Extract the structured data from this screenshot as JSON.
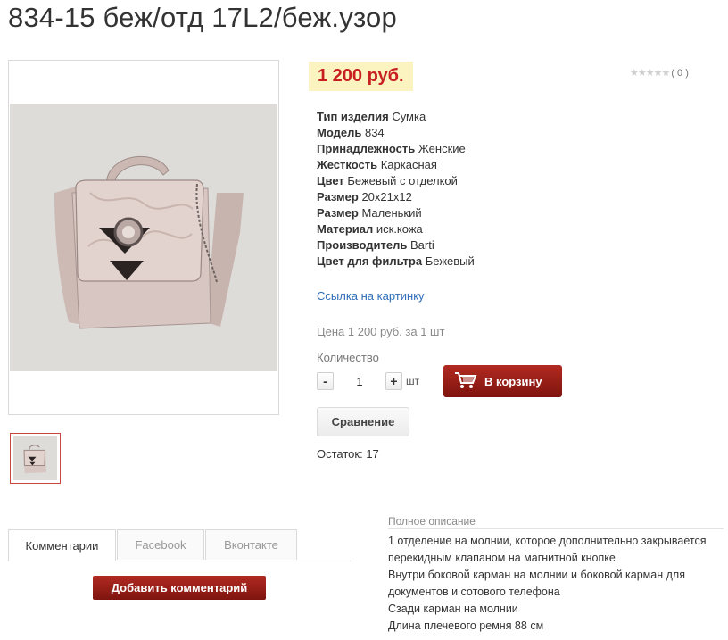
{
  "product": {
    "title": "834-15 беж/отд 17L2/беж.узор",
    "price": "1 200 руб.",
    "rating": {
      "stars": 0,
      "count_label": "( 0 )"
    },
    "properties": [
      {
        "name": "Тип изделия",
        "value": "Сумка"
      },
      {
        "name": "Модель",
        "value": "834"
      },
      {
        "name": "Принадлежность",
        "value": "Женские"
      },
      {
        "name": "Жесткость",
        "value": "Каркасная"
      },
      {
        "name": "Цвет",
        "value": "Бежевый с отделкой"
      },
      {
        "name": "Размер",
        "value": "20x21x12"
      },
      {
        "name": "Размер",
        "value": "Маленький"
      },
      {
        "name": "Материал",
        "value": "иск.кожа"
      },
      {
        "name": "Производитель",
        "value": "Barti"
      },
      {
        "name": "Цвет для фильтра",
        "value": "Бежевый"
      }
    ],
    "image_link": "Ссылка на картинку",
    "unit_price": "Цена 1 200 руб. за 1 шт",
    "stock": "Остаток: 17"
  },
  "cart": {
    "qty_label": "Количество",
    "minus": "-",
    "qty_value": "1",
    "plus": "+",
    "unit": "шт",
    "add_to_cart": "В корзину",
    "compare": "Сравнение"
  },
  "tabs": [
    {
      "label": "Комментарии",
      "active": true
    },
    {
      "label": "Facebook",
      "active": false
    },
    {
      "label": "Вконтакте",
      "active": false
    }
  ],
  "add_comment": "Добавить комментарий",
  "description": {
    "title": "Полное описание",
    "lines": [
      "1 отделение на молнии, которое дополнительно закрывается перекидным клапаном на магнитной кнопке",
      "Внутри боковой карман на молнии и боковой карман для документов и сотового телефона",
      "Сзади карман на молнии",
      "Длина  плечевого ремня 88 см"
    ]
  },
  "colors": {
    "price_bg": "#fbf3c0",
    "price_text": "#c81f1f",
    "button_red": "#9c1f17",
    "link": "#2f6db8"
  },
  "icons": [
    "star-icon",
    "cart-icon"
  ]
}
